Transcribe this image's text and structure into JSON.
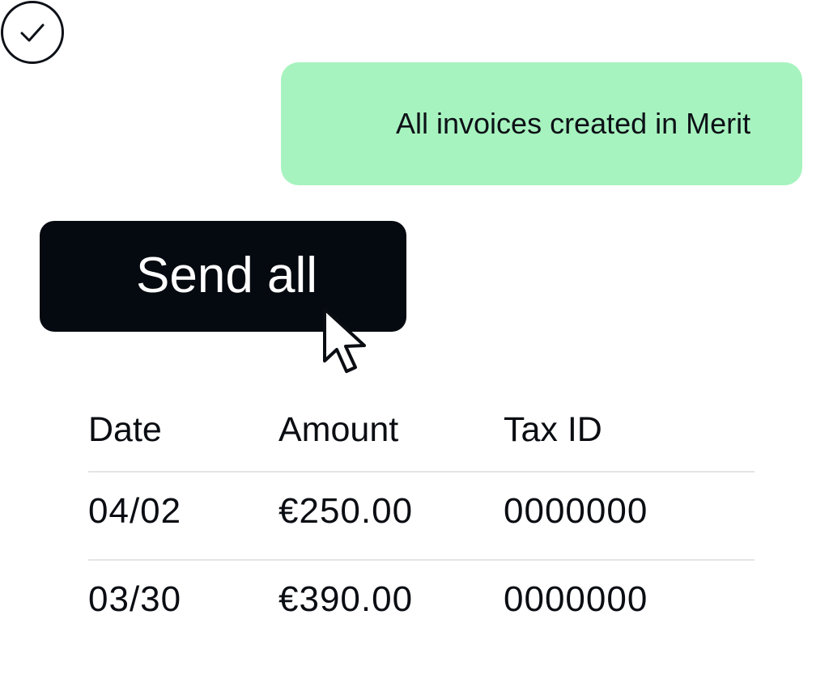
{
  "toast": {
    "message": "All invoices created in Merit",
    "status_color": "#a7f3bf",
    "icon": "check-circle-icon"
  },
  "actions": {
    "send_all_label": "Send all"
  },
  "table": {
    "columns": [
      "Date",
      "Amount",
      "Tax ID"
    ],
    "rows": [
      {
        "date": "04/02",
        "amount": "€250.00",
        "tax_id": "0000000"
      },
      {
        "date": "03/30",
        "amount": "€390.00",
        "tax_id": "0000000"
      }
    ]
  },
  "cursor": {
    "icon": "pointer-cursor-icon"
  }
}
